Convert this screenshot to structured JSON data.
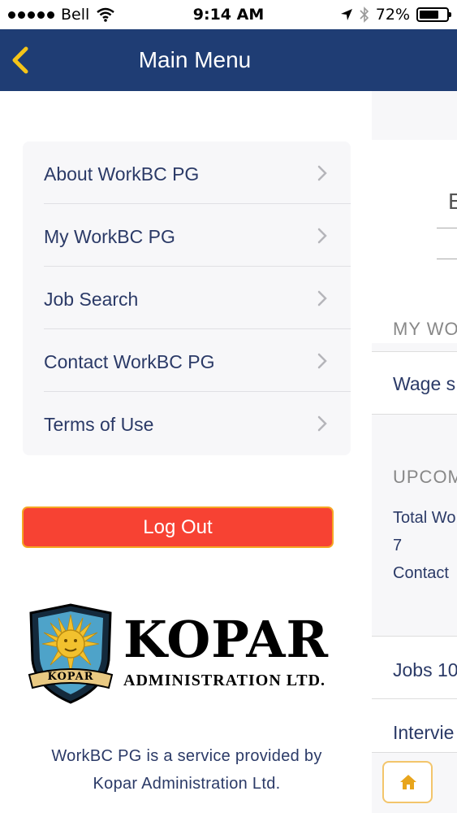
{
  "status_bar": {
    "carrier": "Bell",
    "time": "9:14 AM",
    "battery": "72%",
    "battery_level": 0.72,
    "icons": [
      "signal-dots-icon",
      "wifi-icon",
      "location-arrow-icon",
      "bluetooth-icon",
      "battery-icon"
    ]
  },
  "nav": {
    "title": "Main Menu",
    "back_icon": "chevron-left-icon",
    "accent": "#f5c518",
    "background": "#1f3d74"
  },
  "menu": {
    "items": [
      {
        "label": "About WorkBC PG"
      },
      {
        "label": "My WorkBC PG"
      },
      {
        "label": "Job Search"
      },
      {
        "label": "Contact WorkBC PG"
      },
      {
        "label": "Terms of Use"
      }
    ]
  },
  "logout": {
    "label": "Log Out",
    "color": "#f74233"
  },
  "logo": {
    "name": "KOPAR",
    "subtitle": "ADMINISTRATION LTD.",
    "shield_text": "KOPAR"
  },
  "footer": {
    "line1": "WorkBC PG is a service provided by",
    "line2": "Kopar Administration Ltd."
  },
  "background_page": {
    "field_text": "E",
    "section1": "MY WO",
    "row1": "Wage s",
    "section2": "UPCOM",
    "info_line1": "Total Wo",
    "info_line2": "7",
    "info_line3": "Contact",
    "row2": "Jobs 10",
    "row3": "Intervie",
    "home_icon": "home-icon"
  }
}
